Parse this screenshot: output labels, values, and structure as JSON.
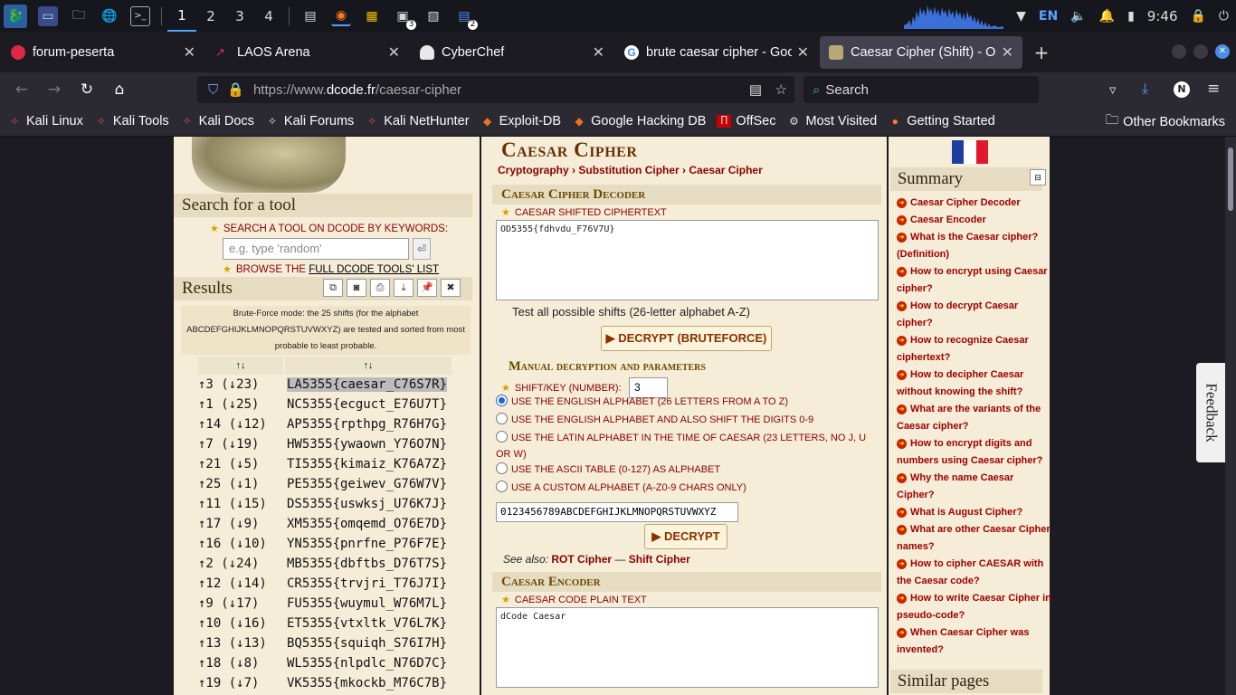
{
  "taskbar": {
    "workspaces": [
      "1",
      "2",
      "3",
      "4"
    ],
    "active_workspace": "1",
    "language": "EN",
    "time": "9:46",
    "term_badge": "3",
    "files_badge": "2"
  },
  "tabs": [
    {
      "title": "forum-peserta",
      "icon": "ctfd-icon",
      "color": "#e0264a"
    },
    {
      "title": "LAOS Arena",
      "icon": "laos-icon",
      "color": "#d62d4e"
    },
    {
      "title": "CyberChef",
      "icon": "chef-icon",
      "color": "#e8e8e8"
    },
    {
      "title": "brute caesar cipher - Goo",
      "icon": "google-icon",
      "color": "#4285f4"
    },
    {
      "title": "Caesar Cipher (Shift) - On",
      "icon": "dcode-icon",
      "color": "#b8a878",
      "active": true
    }
  ],
  "nav": {
    "url_prefix": "https://www.",
    "url_host": "dcode.fr",
    "url_path": "/caesar-cipher",
    "search_placeholder": "Search",
    "profile_initial": "N"
  },
  "bookmarks": [
    {
      "label": "Kali Linux",
      "icon": "kali-icon"
    },
    {
      "label": "Kali Tools",
      "icon": "kali-icon"
    },
    {
      "label": "Kali Docs",
      "icon": "kali-icon"
    },
    {
      "label": "Kali Forums",
      "icon": "kali-icon"
    },
    {
      "label": "Kali NetHunter",
      "icon": "kali-icon"
    },
    {
      "label": "Exploit-DB",
      "icon": "exploitdb-icon"
    },
    {
      "label": "Google Hacking DB",
      "icon": "exploitdb-icon"
    },
    {
      "label": "OffSec",
      "icon": "offsec-icon"
    },
    {
      "label": "Most Visited",
      "icon": "gear-icon"
    },
    {
      "label": "Getting Started",
      "icon": "firefox-icon"
    }
  ],
  "other_bookmarks": "Other Bookmarks",
  "left": {
    "search_heading": "Search for a tool",
    "search_kw_label": "SEARCH A TOOL ON DCODE BY KEYWORDS:",
    "search_placeholder": "e.g. type 'random'",
    "browse_prefix": "BROWSE THE",
    "browse_link": "FULL DCODE TOOLS' LIST",
    "results_heading": "Results",
    "bf_note": "Brute-Force mode: the 25 shifts (for the alphabet ABCDEFGHIJKLMNOPQRSTUVWXYZ) are tested and sorted from most probable to least probable.",
    "col1": "↑↓",
    "col2": "↑↓",
    "rows": [
      {
        "shift": "↑3 (↓23)",
        "text": "LA5355{caesar_C76S7R}",
        "selected": true
      },
      {
        "shift": "↑1 (↓25)",
        "text": "NC5355{ecguct_E76U7T}"
      },
      {
        "shift": "↑14 (↓12)",
        "text": "AP5355{rpthpg_R76H7G}"
      },
      {
        "shift": "↑7 (↓19)",
        "text": "HW5355{ywaown_Y76O7N}"
      },
      {
        "shift": "↑21 (↓5)",
        "text": "TI5355{kimaiz_K76A7Z}"
      },
      {
        "shift": "↑25 (↓1)",
        "text": "PE5355{geiwev_G76W7V}"
      },
      {
        "shift": "↑11 (↓15)",
        "text": "DS5355{uswksj_U76K7J}"
      },
      {
        "shift": "↑17 (↓9)",
        "text": "XM5355{omqemd_O76E7D}"
      },
      {
        "shift": "↑16 (↓10)",
        "text": "YN5355{pnrfne_P76F7E}"
      },
      {
        "shift": "↑2 (↓24)",
        "text": "MB5355{dbftbs_D76T7S}"
      },
      {
        "shift": "↑12 (↓14)",
        "text": "CR5355{trvjri_T76J7I}"
      },
      {
        "shift": "↑9 (↓17)",
        "text": "FU5355{wuymul_W76M7L}"
      },
      {
        "shift": "↑10 (↓16)",
        "text": "ET5355{vtxltk_V76L7K}"
      },
      {
        "shift": "↑13 (↓13)",
        "text": "BQ5355{squiqh_S76I7H}"
      },
      {
        "shift": "↑18 (↓8)",
        "text": "WL5355{nlpdlc_N76D7C}"
      },
      {
        "shift": "↑19 (↓7)",
        "text": "VK5355{mkockb_M76C7B}"
      }
    ]
  },
  "mid": {
    "title": "Caesar Cipher",
    "crumbs": [
      "Cryptography",
      "Substitution Cipher",
      "Caesar Cipher"
    ],
    "decoder_heading": "Caesar Cipher Decoder",
    "ciphertext_label": "CAESAR SHIFTED CIPHERTEXT",
    "ciphertext": "OD5355{fdhvdu_F76V7U}",
    "test_all": "Test all possible shifts (26-letter alphabet A-Z)",
    "bruteforce_btn": "▶ DECRYPT (BRUTEFORCE)",
    "manual_heading": "Manual decryption and parameters",
    "shift_label": "SHIFT/KEY (NUMBER):",
    "shift_value": "3",
    "radios": [
      {
        "label": "USE THE ENGLISH ALPHABET (26 LETTERS FROM A TO Z)",
        "checked": true
      },
      {
        "label": "USE THE ENGLISH ALPHABET AND ALSO SHIFT THE DIGITS 0-9",
        "checked": false
      },
      {
        "label": "USE THE LATIN ALPHABET IN THE TIME OF CAESAR (23 LETTERS, NO J, U OR W)",
        "checked": false
      },
      {
        "label": "USE THE ASCII TABLE (0-127) AS ALPHABET",
        "checked": false
      },
      {
        "label": "USE A CUSTOM ALPHABET (A-Z0-9 CHARS ONLY)",
        "checked": false
      }
    ],
    "custom_alphabet": "0123456789ABCDEFGHIJKLMNOPQRSTUVWXYZ",
    "decrypt_btn": "▶ DECRYPT",
    "see_also_label": "See also:",
    "see_also_1": "ROT Cipher",
    "see_also_sep": "—",
    "see_also_2": "Shift Cipher",
    "encoder_heading": "Caesar Encoder",
    "plaintext_label": "CAESAR CODE PLAIN TEXT",
    "plaintext": "dCode Caesar"
  },
  "right": {
    "summary_heading": "Summary",
    "items": [
      "Caesar Cipher Decoder",
      "Caesar Encoder",
      "What is the Caesar cipher? (Definition)",
      "How to encrypt using Caesar cipher?",
      "How to decrypt Caesar cipher?",
      "How to recognize Caesar ciphertext?",
      "How to decipher Caesar without knowing the shift?",
      "What are the variants of the Caesar cipher?",
      "How to encrypt digits and numbers using Caesar cipher?",
      "Why the name Caesar Cipher?",
      "What is August Cipher?",
      "What are other Caesar Cipher names?",
      "How to cipher CAESAR with the Caesar code?",
      "How to write Caesar Cipher in pseudo-code?",
      "When Caesar Cipher was invented?"
    ],
    "similar_heading": "Similar pages"
  },
  "feedback": "Feedback"
}
